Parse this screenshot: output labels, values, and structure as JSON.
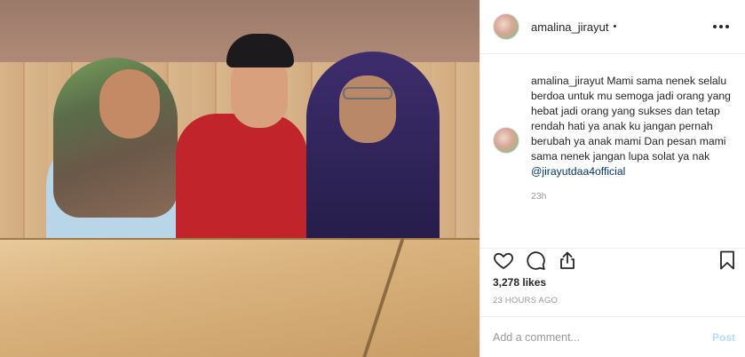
{
  "post": {
    "username": "amalina_jirayut",
    "dot": "•",
    "photo_alt": "Three people sitting at a wooden table making finger-heart gestures"
  },
  "caption": {
    "username": "amalina_jirayut",
    "text": "Mami sama nenek selalu berdoa untuk mu semoga jadi orang yang hebat jadi orang yang sukses dan tetap rendah hati ya anak ku jangan pernah berubah ya anak mami Dan pesan mami sama nenek jangan lupa solat ya nak",
    "mention": "@jirayutdaa4official",
    "time": "23h"
  },
  "stats": {
    "likes": "3,278 likes",
    "posted_ago": "23 HOURS AGO"
  },
  "comment": {
    "placeholder": "Add a comment...",
    "post_label": "Post"
  },
  "icons": {
    "like": "heart-icon",
    "comment": "comment-icon",
    "share": "share-icon",
    "save": "bookmark-icon",
    "more": "more-options-icon"
  },
  "colors": {
    "link": "#003569",
    "muted": "#999999",
    "post_disabled": "#b3dbff",
    "border": "#efefef"
  }
}
